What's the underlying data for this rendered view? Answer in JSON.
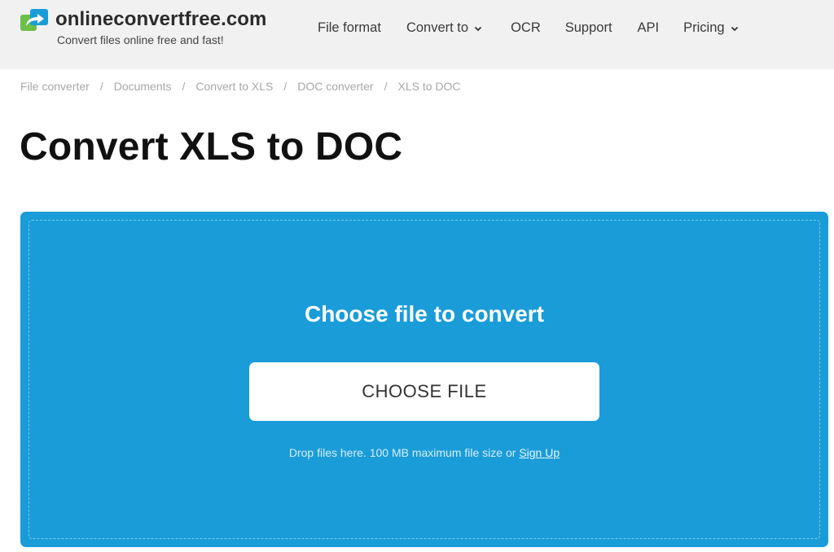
{
  "brand": {
    "name": "onlineconvertfree.com",
    "tagline": "Convert files online free and fast!",
    "icon": "arrow-share-logo-icon",
    "colors": {
      "blue": "#1a9cd8",
      "green": "#6cc04a"
    }
  },
  "nav": {
    "items": [
      {
        "label": "File format",
        "dropdown": false
      },
      {
        "label": "Convert to",
        "dropdown": true
      },
      {
        "label": "OCR",
        "dropdown": false
      },
      {
        "label": "Support",
        "dropdown": false
      },
      {
        "label": "API",
        "dropdown": false
      },
      {
        "label": "Pricing",
        "dropdown": true
      }
    ]
  },
  "breadcrumb": {
    "items": [
      "File converter",
      "Documents",
      "Convert to XLS",
      "DOC converter",
      "XLS to DOC"
    ],
    "separator": "/"
  },
  "page": {
    "title": "Convert XLS to DOC"
  },
  "upload": {
    "title": "Choose file to convert",
    "button_label": "CHOOSE FILE",
    "hint": "Drop files here. 100 MB maximum file size or ",
    "signup_label": "Sign Up",
    "background": "#1a9cd8"
  }
}
